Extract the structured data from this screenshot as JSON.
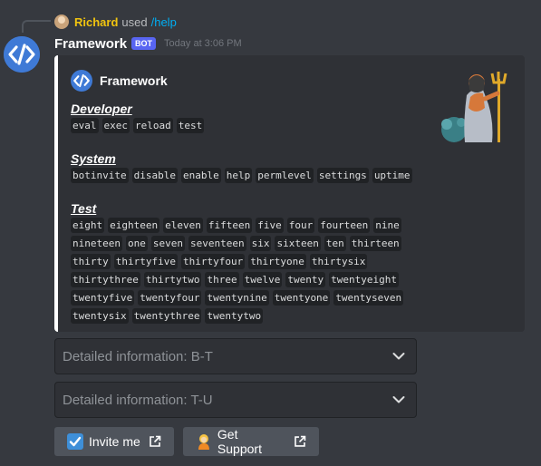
{
  "reply": {
    "user": "Richard",
    "action": "used",
    "command": "/help"
  },
  "message": {
    "author": "Framework",
    "bot_tag": "BOT",
    "timestamp": "Today at 3:06 PM"
  },
  "embed": {
    "author": "Framework",
    "border_color": "#ffffff",
    "fields": [
      {
        "name": "Developer",
        "commands": [
          "eval",
          "exec",
          "reload",
          "test"
        ]
      },
      {
        "name": "System",
        "commands": [
          "botinvite",
          "disable",
          "enable",
          "help",
          "permlevel",
          "settings",
          "uptime"
        ]
      },
      {
        "name": "Test",
        "commands": [
          "eight",
          "eighteen",
          "eleven",
          "fifteen",
          "five",
          "four",
          "fourteen",
          "nine",
          "nineteen",
          "one",
          "seven",
          "seventeen",
          "six",
          "sixteen",
          "ten",
          "thirteen",
          "thirty",
          "thirtyfive",
          "thirtyfour",
          "thirtyone",
          "thirtysix",
          "thirtythree",
          "thirtytwo",
          "three",
          "twelve",
          "twenty",
          "twentyeight",
          "twentyfive",
          "twentyfour",
          "twentynine",
          "twentyone",
          "twentyseven",
          "twentysix",
          "twentythree",
          "twentytwo"
        ]
      }
    ]
  },
  "selects": [
    {
      "placeholder": "Detailed information: B-T",
      "icon": "chevron-down-icon"
    },
    {
      "placeholder": "Detailed information: T-U",
      "icon": "chevron-down-icon"
    }
  ],
  "buttons": [
    {
      "label": "Invite me",
      "icon": "checkbox-icon",
      "trail_icon": "external-link-icon"
    },
    {
      "label": "Get Support",
      "icon": "person-icon",
      "trail_icon": "external-link-icon"
    }
  ],
  "colors": {
    "background": "#36393f",
    "embed_bg": "#2f3136",
    "bot_tag": "#5865f2",
    "reply_name": "#f1c40f",
    "command_link": "#00aff4",
    "avatar": "#3f7ad6"
  }
}
